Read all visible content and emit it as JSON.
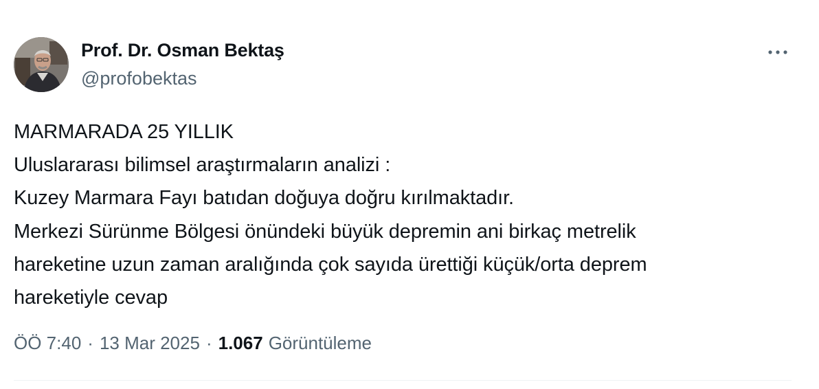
{
  "author": {
    "name": "Prof. Dr. Osman Bektaş",
    "handle": "@profobektas"
  },
  "tweet": {
    "lines": [
      "MARMARADA 25 YILLIK",
      "Uluslararası bilimsel araştırmaların analizi :",
      "Kuzey Marmara Fayı batıdan doğuya doğru kırılmaktadır.",
      "Merkezi Sürünme Bölgesi önündeki büyük depremin ani birkaç metrelik",
      "hareketine uzun zaman aralığında çok sayıda ürettiği küçük/orta deprem",
      "hareketiyle cevap"
    ]
  },
  "meta": {
    "time": "ÖÖ 7:40",
    "separator": "·",
    "date": "13 Mar 2025",
    "views_count": "1.067",
    "views_label": "Görüntüleme"
  },
  "colors": {
    "text_primary": "#0f1419",
    "text_secondary": "#536471",
    "divider": "#eff3f4"
  },
  "icons": {
    "more": "more-horizontal-icon"
  }
}
